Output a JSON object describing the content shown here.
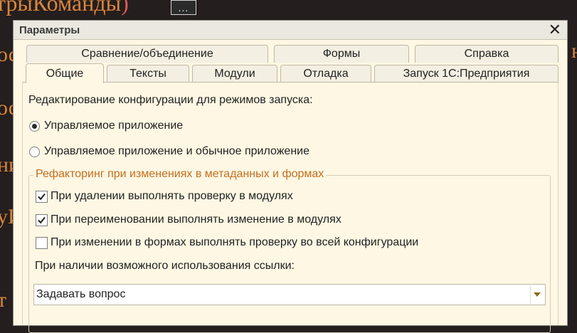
{
  "background": {
    "code_text": "трыКоманды",
    "code_paren": ")",
    "more_button": "...",
    "left_fragments": [
      "ос",
      "ни",
      "уИ",
      "т"
    ],
    "right_fragment": "н"
  },
  "dialog": {
    "title": "Параметры",
    "tabs_row1": [
      {
        "label": "Сравнение/объединение"
      },
      {
        "label": "Формы"
      },
      {
        "label": "Справка"
      }
    ],
    "tabs_row2": [
      {
        "label": "Общие",
        "active": true
      },
      {
        "label": "Тексты"
      },
      {
        "label": "Модули"
      },
      {
        "label": "Отладка"
      },
      {
        "label": "Запуск 1С:Предприятия"
      }
    ],
    "section_label": "Редактирование конфигурации для режимов запуска:",
    "radios": [
      {
        "label": "Управляемое приложение",
        "checked": true
      },
      {
        "label": "Управляемое приложение и обычное приложение",
        "checked": false
      }
    ],
    "group": {
      "title": "Рефакторинг при изменениях в метаданных и формах",
      "checkboxes": [
        {
          "label": "При удалении выполнять проверку в модулях",
          "checked": true
        },
        {
          "label": "При переименовании выполнять изменение в модулях",
          "checked": true
        },
        {
          "label": "При изменении в формах выполнять проверку во всей конфигурации",
          "checked": false
        }
      ],
      "ref_label": "При наличии возможного использования ссылки:",
      "select_value": "Задавать вопрос"
    }
  },
  "colors": {
    "dialog_bg": "#fdf7e3",
    "legend": "#c46f1e",
    "code": "#d9853b",
    "code_paren": "#e05a5a",
    "dropdown_arrow": "#8a6a17"
  },
  "icons": [
    "close-icon",
    "check-icon",
    "chevron-down-icon",
    "more-icon"
  ]
}
